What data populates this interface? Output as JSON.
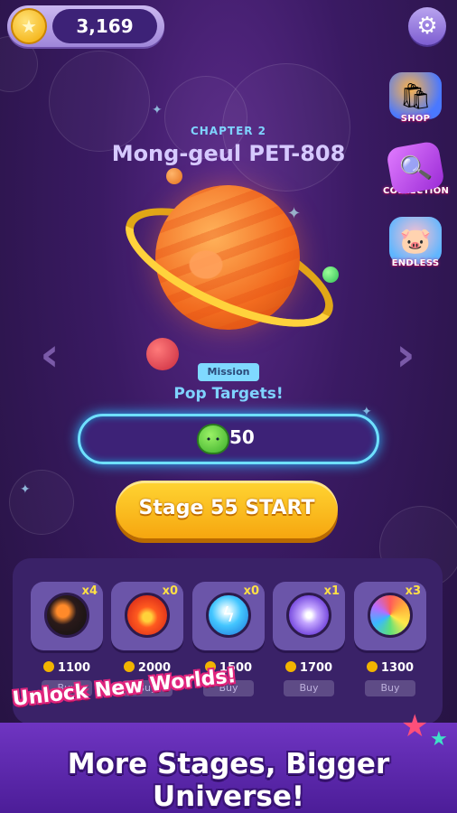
{
  "top_bar": {
    "coin_count": "3,169"
  },
  "side_menu": [
    {
      "label": "SHOP",
      "icon": "shop-icon",
      "color": "#4a78ff"
    },
    {
      "label": "COLLECTION",
      "icon": "collection-icon",
      "color": "#c34bff"
    },
    {
      "label": "ENDLESS",
      "icon": "endless-icon",
      "color": "#ff8aa8"
    }
  ],
  "chapter": {
    "label": "CHAPTER 2",
    "title": "Mong-geul PET-808"
  },
  "mission": {
    "badge": "Mission",
    "text": "Pop Targets!",
    "target_count": "50"
  },
  "start_button": {
    "label": "Stage 55 START"
  },
  "items": [
    {
      "count": "x4",
      "price": "1100",
      "buy": "Buy",
      "icon": "bomb-icon"
    },
    {
      "count": "x0",
      "price": "2000",
      "buy": "Buy",
      "icon": "fire-icon"
    },
    {
      "count": "x0",
      "price": "1500",
      "buy": "Buy",
      "icon": "lightning-icon"
    },
    {
      "count": "x1",
      "price": "1700",
      "buy": "Buy",
      "icon": "purple-orb-icon"
    },
    {
      "count": "x3",
      "price": "1300",
      "buy": "Buy",
      "icon": "rainbow-orb-icon"
    }
  ],
  "promo": {
    "subtitle": "Unlock New Worlds!",
    "headline": "More Stages, Bigger Universe!"
  },
  "colors": {
    "accent_cyan": "#6fe0ff",
    "start_yellow": "#ffd533",
    "background": "#3a1a63"
  }
}
